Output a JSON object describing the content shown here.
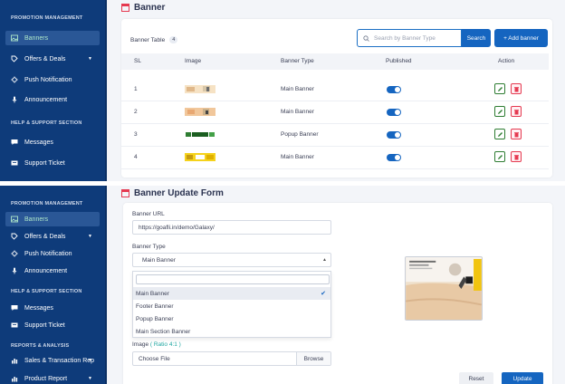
{
  "colors": {
    "sidebar": "#0e3b7a",
    "sidebar_active": "#2a5796",
    "primary": "#1565c0",
    "danger": "#e53950",
    "success": "#2e7d32"
  },
  "list_view": {
    "sidebar": {
      "section_promotion": "PROMOTION MANAGEMENT",
      "items": [
        {
          "label": "Banners",
          "icon": "image-icon",
          "active": true
        },
        {
          "label": "Offers & Deals",
          "icon": "tag-icon",
          "caret": "▼"
        },
        {
          "label": "Push Notification",
          "icon": "gear-icon"
        },
        {
          "label": "Announcement",
          "icon": "microphone-icon"
        }
      ],
      "section_help": "HELP & SUPPORT SECTION",
      "help_items": [
        {
          "label": "Messages",
          "icon": "chat-icon"
        },
        {
          "label": "Support Ticket",
          "icon": "ticket-icon"
        }
      ]
    },
    "page_title": "Banner",
    "table_title": "Banner Table",
    "count": "4",
    "search": {
      "placeholder": "Search by Banner Type",
      "button": "Search"
    },
    "add_button": "+ Add banner",
    "columns": [
      "SL",
      "Image",
      "Banner Type",
      "Published",
      "Action"
    ],
    "rows": [
      {
        "sl": "1",
        "type": "Main Banner",
        "published": true
      },
      {
        "sl": "2",
        "type": "Main Banner",
        "published": true
      },
      {
        "sl": "3",
        "type": "Popup Banner",
        "published": true
      },
      {
        "sl": "4",
        "type": "Main Banner",
        "published": true
      }
    ]
  },
  "form_view": {
    "sidebar": {
      "section_promotion": "PROMOTION MANAGEMENT",
      "items": [
        {
          "label": "Banners",
          "icon": "image-icon",
          "active": true
        },
        {
          "label": "Offers & Deals",
          "icon": "tag-icon",
          "caret": "▼"
        },
        {
          "label": "Push Notification",
          "icon": "gear-icon"
        },
        {
          "label": "Announcement",
          "icon": "microphone-icon"
        }
      ],
      "section_help": "HELP & SUPPORT SECTION",
      "help_items": [
        {
          "label": "Messages",
          "icon": "chat-icon"
        },
        {
          "label": "Support Ticket",
          "icon": "ticket-icon"
        }
      ],
      "section_reports": "REPORTS & ANALYSIS",
      "report_items": [
        {
          "label": "Sales & Transaction Rep",
          "icon": "chart-icon",
          "caret": "▼"
        },
        {
          "label": "Product Report",
          "icon": "chart-icon",
          "caret": "▼"
        }
      ]
    },
    "page_title": "Banner Update Form",
    "url_label": "Banner URL",
    "url_value": "https://goafli.in/demo/Galaxy/",
    "type_label": "Banner Type",
    "type_value": "Main Banner",
    "options": [
      "Main Banner",
      "Footer Banner",
      "Popup Banner",
      "Main Section Banner"
    ],
    "selected_option": "Main Banner",
    "image_label": "Image",
    "image_ratio": "( Ratio 4:1 )",
    "choose_file": "Choose File",
    "browse": "Browse",
    "reset": "Reset",
    "update": "Update"
  }
}
